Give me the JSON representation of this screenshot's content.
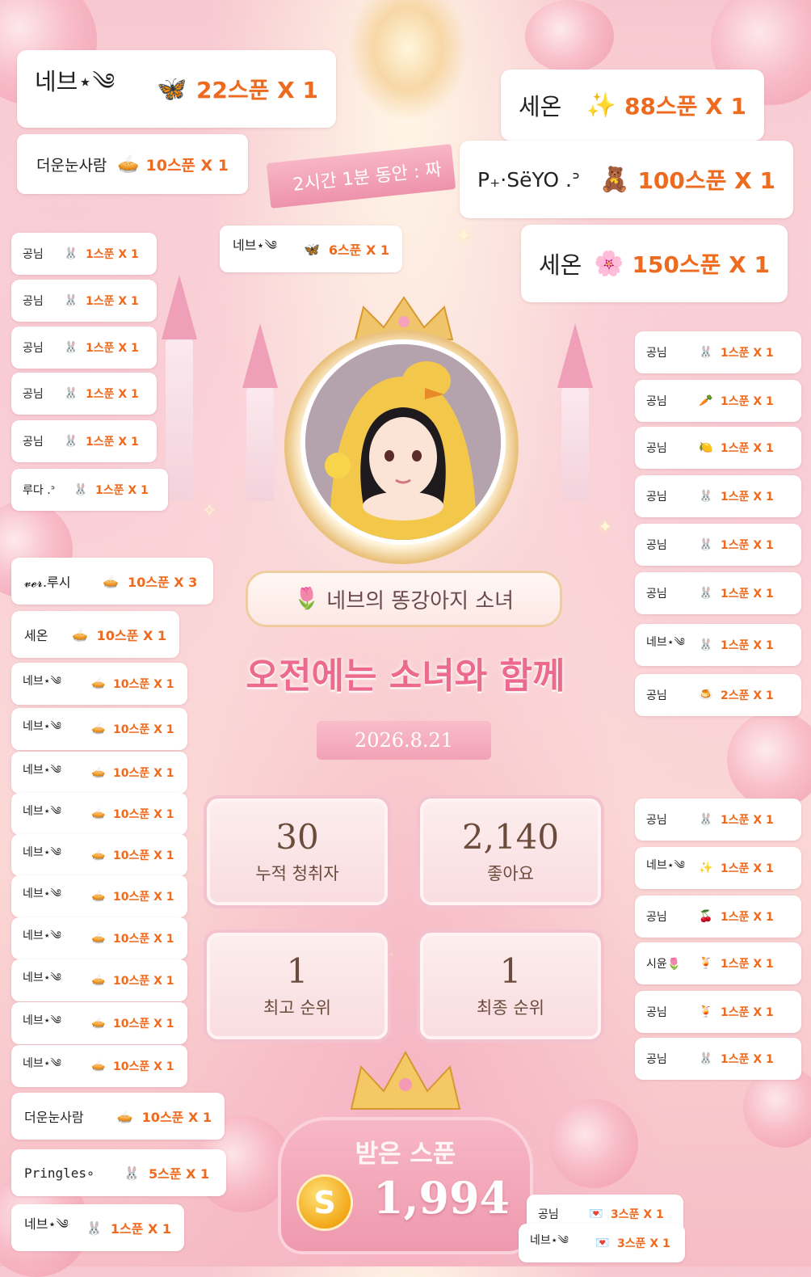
{
  "banner": {
    "timer_text": "2시간 1분 동안 : 짜"
  },
  "profile": {
    "name": "네브의 똥강아지 소녀",
    "name_emoji": "🌷"
  },
  "headline": "오전에는 소녀와 함께",
  "date": "2026.8.21",
  "stats": {
    "listeners": {
      "value": "30",
      "label": "누적 청취자"
    },
    "likes": {
      "value": "2,140",
      "label": "좋아요"
    },
    "best_rank": {
      "value": "1",
      "label": "최고 순위"
    },
    "final_rank": {
      "value": "1",
      "label": "최종 순위"
    }
  },
  "spoons": {
    "title": "받은 스푼",
    "coin_symbol": "S",
    "total": "1,994"
  },
  "donations": {
    "d01": {
      "name": "네브⋆༄",
      "icon": "🦋",
      "amount": "22스푼 X 1"
    },
    "d02": {
      "name": "더운눈사람",
      "icon": "🥧",
      "amount": "10스푼 X 1"
    },
    "d03": {
      "name": "네브⋆༄",
      "icon": "🦋",
      "amount": "6스푼 X 1"
    },
    "d04": {
      "name": "세온",
      "icon": "✨",
      "amount": "88스푼 X 1"
    },
    "d05": {
      "name": "P₊·SëYO .ᐣ",
      "icon": "🧸",
      "amount": "100스푼 X 1"
    },
    "d06": {
      "name": "세온",
      "icon": "🌸",
      "amount": "150스푼 X 1"
    },
    "l01": {
      "name": "공님",
      "icon": "🐰",
      "amount": "1스푼 X 1"
    },
    "l02": {
      "name": "공님",
      "icon": "🐰",
      "amount": "1스푼 X 1"
    },
    "l03": {
      "name": "공님",
      "icon": "🐰",
      "amount": "1스푼 X 1"
    },
    "l04": {
      "name": "공님",
      "icon": "🐰",
      "amount": "1스푼 X 1"
    },
    "l05": {
      "name": "공님",
      "icon": "🐰",
      "amount": "1스푼 X 1"
    },
    "l06": {
      "name": "루다 .ᐣ",
      "icon": "🐰",
      "amount": "1스푼 X 1"
    },
    "l07": {
      "name": "𝓿𝓮𝓻.루시",
      "icon": "🥧",
      "amount": "10스푼 X 3"
    },
    "l08": {
      "name": "세온",
      "icon": "🥧",
      "amount": "10스푼 X 1"
    },
    "l09": {
      "name": "네브⋆༄",
      "icon": "🥧",
      "amount": "10스푼 X 1"
    },
    "l10": {
      "name": "네브⋆༄",
      "icon": "🥧",
      "amount": "10스푼 X 1"
    },
    "l11": {
      "name": "네브⋆༄",
      "icon": "🥧",
      "amount": "10스푼 X 1"
    },
    "l12": {
      "name": "네브⋆༄",
      "icon": "🥧",
      "amount": "10스푼 X 1"
    },
    "l13": {
      "name": "네브⋆༄",
      "icon": "🥧",
      "amount": "10스푼 X 1"
    },
    "l14": {
      "name": "네브⋆༄",
      "icon": "🥧",
      "amount": "10스푼 X 1"
    },
    "l15": {
      "name": "네브⋆༄",
      "icon": "🥧",
      "amount": "10스푼 X 1"
    },
    "l16": {
      "name": "네브⋆༄",
      "icon": "🥧",
      "amount": "10스푼 X 1"
    },
    "l17": {
      "name": "네브⋆༄",
      "icon": "🥧",
      "amount": "10스푼 X 1"
    },
    "l18": {
      "name": "네브⋆༄",
      "icon": "🥧",
      "amount": "10스푼 X 1"
    },
    "l19": {
      "name": "더운눈사람",
      "icon": "🥧",
      "amount": "10스푼 X 1"
    },
    "l20": {
      "name": "Pringles∘",
      "icon": "🐰",
      "amount": "5스푼 X 1"
    },
    "l21": {
      "name": "네브⋆༄",
      "icon": "🐰",
      "amount": "1스푼 X 1"
    },
    "r01": {
      "name": "공님",
      "icon": "🐰",
      "amount": "1스푼 X 1"
    },
    "r02": {
      "name": "공님",
      "icon": "🥕",
      "amount": "1스푼 X 1"
    },
    "r03": {
      "name": "공님",
      "icon": "🍋",
      "amount": "1스푼 X 1"
    },
    "r04": {
      "name": "공님",
      "icon": "🐰",
      "amount": "1스푼 X 1"
    },
    "r05": {
      "name": "공님",
      "icon": "🐰",
      "amount": "1스푼 X 1"
    },
    "r06": {
      "name": "공님",
      "icon": "🐰",
      "amount": "1스푼 X 1"
    },
    "r07": {
      "name": "네브⋆༄",
      "icon": "🐰",
      "amount": "1스푼 X 1"
    },
    "r08": {
      "name": "공님",
      "icon": "🍮",
      "amount": "2스푼 X 1"
    },
    "r09": {
      "name": "공님",
      "icon": "🐰",
      "amount": "1스푼 X 1"
    },
    "r10": {
      "name": "네브⋆༄",
      "icon": "✨",
      "amount": "1스푼 X 1"
    },
    "r11": {
      "name": "공님",
      "icon": "🍒",
      "amount": "1스푼 X 1"
    },
    "r12": {
      "name": "시윤🌷",
      "icon": "🍹",
      "amount": "1스푼 X 1"
    },
    "r13": {
      "name": "공님",
      "icon": "🍹",
      "amount": "1스푼 X 1"
    },
    "r14": {
      "name": "공님",
      "icon": "🐰",
      "amount": "1스푼 X 1"
    },
    "b01": {
      "name": "공님",
      "icon": "💌",
      "amount": "3스푼 X 1"
    },
    "b02": {
      "name": "네브⋆༄",
      "icon": "💌",
      "amount": "3스푼 X 1"
    }
  }
}
